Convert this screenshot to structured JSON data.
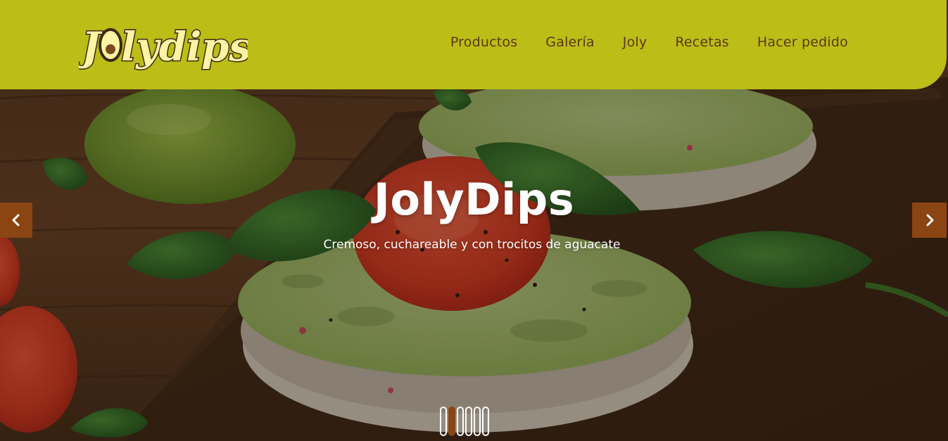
{
  "brand": {
    "logo_text": "Jolydips",
    "color_header": "#bcbd17",
    "color_brown": "#8b4513",
    "color_nav_text": "#5a3813"
  },
  "nav": {
    "items": [
      {
        "label": "Productos"
      },
      {
        "label": "Galería"
      },
      {
        "label": "Joly"
      },
      {
        "label": "Recetas"
      },
      {
        "label": "Hacer pedido"
      }
    ]
  },
  "slide": {
    "title": "JolyDips",
    "subtitle": "Cremoso, cuchareable y con trocitos de aguacate"
  },
  "carousel": {
    "prev_icon": "chevron-left-icon",
    "next_icon": "chevron-right-icon",
    "indicator_count": 6,
    "active_index": 1
  }
}
